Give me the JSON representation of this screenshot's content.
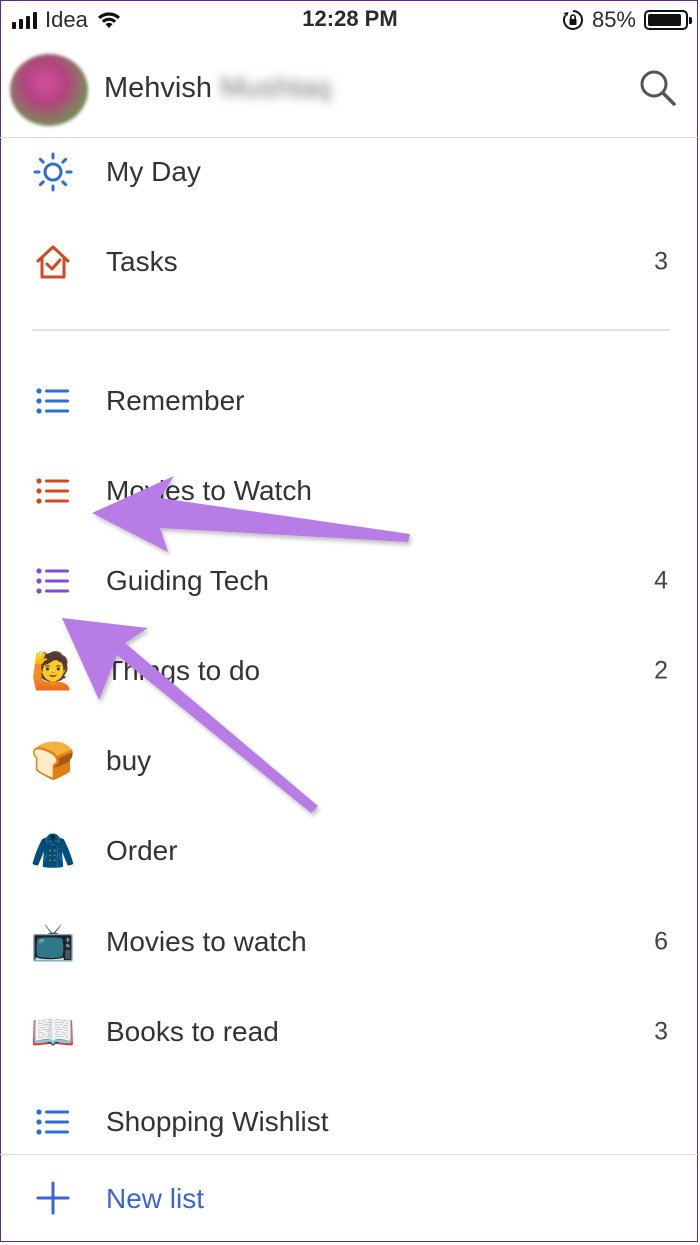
{
  "status_bar": {
    "carrier": "Idea",
    "time": "12:28 PM",
    "battery_percent": "85%",
    "battery_level": 0.85
  },
  "header": {
    "user_first_name": "Mehvish",
    "user_last_name_blurred": "Mushtaq",
    "search_icon": "search-icon"
  },
  "smart_lists": [
    {
      "label": "My Day",
      "count": "",
      "icon": "sun-icon",
      "color": "#2d6ed6"
    },
    {
      "label": "Tasks",
      "count": "3",
      "icon": "house-check-icon",
      "color": "#d2491f"
    }
  ],
  "lists": [
    {
      "label": "Remember",
      "count": "",
      "icon": "list-icon",
      "color": "#2d6ed6"
    },
    {
      "label": "Movies to Watch",
      "count": "",
      "icon": "list-icon",
      "color": "#d2491f"
    },
    {
      "label": "Guiding Tech",
      "count": "4",
      "icon": "list-icon",
      "color": "#7b4fd0"
    },
    {
      "label": "Things to do",
      "count": "2",
      "icon": "emoji-raising-hand",
      "emoji": "🙋"
    },
    {
      "label": "buy",
      "count": "",
      "icon": "emoji-bread",
      "emoji": "🍞"
    },
    {
      "label": "Order",
      "count": "",
      "icon": "emoji-coat",
      "emoji": "🧥"
    },
    {
      "label": "Movies to watch",
      "count": "6",
      "icon": "emoji-television",
      "emoji": "📺"
    },
    {
      "label": "Books to read",
      "count": "3",
      "icon": "emoji-open-book",
      "emoji": "📖"
    },
    {
      "label": "Shopping Wishlist",
      "count": "",
      "icon": "list-icon",
      "color": "#2d6ed6"
    }
  ],
  "footer": {
    "new_list_label": "New list",
    "accent": "#3b63d6"
  },
  "annotation_color": "#b77ce6"
}
